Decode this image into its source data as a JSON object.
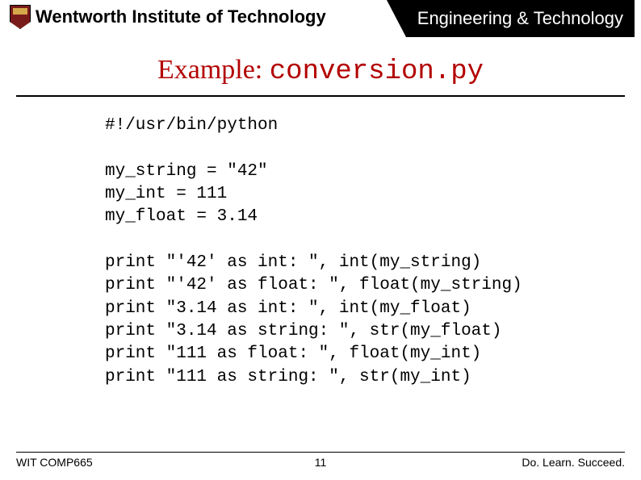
{
  "header": {
    "institution": "Wentworth Institute of Technology",
    "department": "Engineering & Technology"
  },
  "title": {
    "prefix": "Example: ",
    "file": "conversion.py"
  },
  "code": "#!/usr/bin/python\n\nmy_string = \"42\"\nmy_int = 111\nmy_float = 3.14\n\nprint \"'42' as int: \", int(my_string)\nprint \"'42' as float: \", float(my_string)\nprint \"3.14 as int: \", int(my_float)\nprint \"3.14 as string: \", str(my_float)\nprint \"111 as float: \", float(my_int)\nprint \"111 as string: \", str(my_int)",
  "footer": {
    "course": "WIT COMP665",
    "page": "11",
    "motto": "Do. Learn. Succeed."
  }
}
